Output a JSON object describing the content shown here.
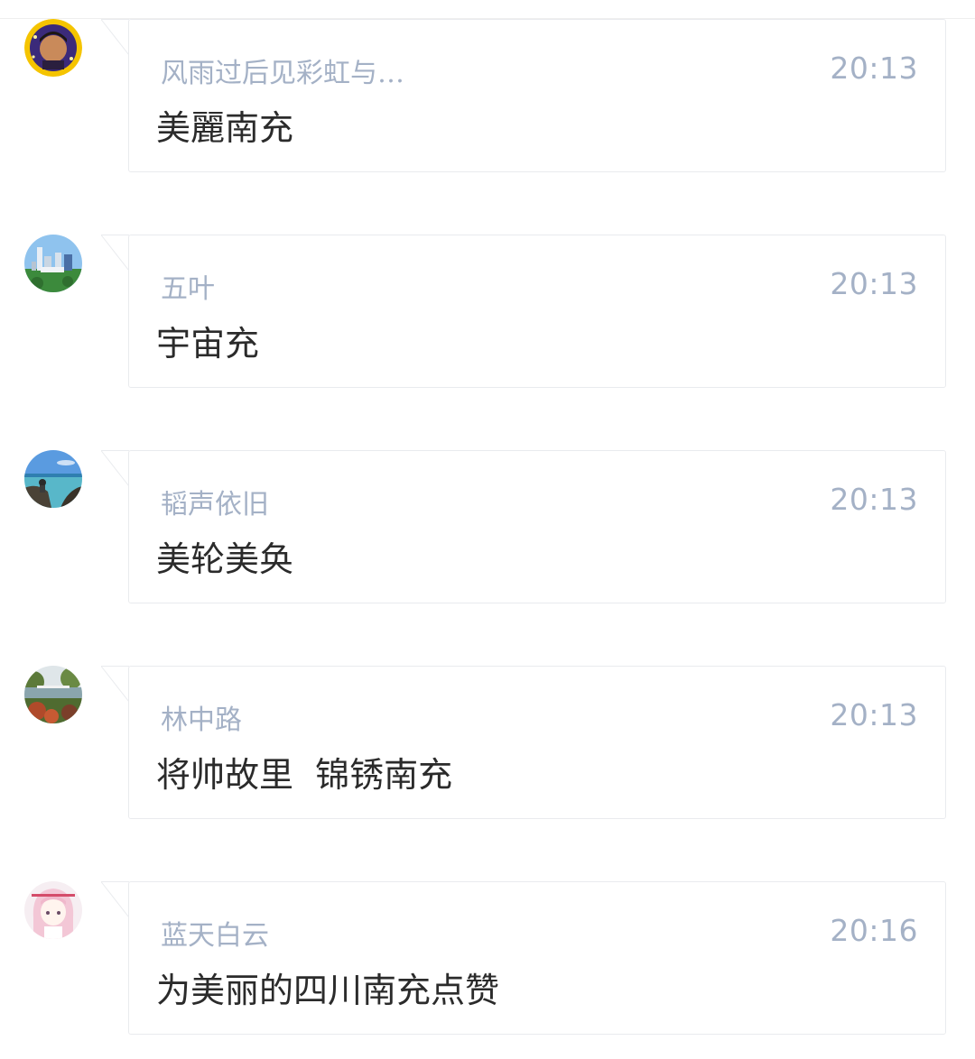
{
  "comments": [
    {
      "author": "风雨过后见彩虹与…",
      "time": "20:13",
      "text": "美麗南充",
      "avatar_icon": "portrait-avatar-icon",
      "avatar_colors": {
        "ring": "#f5c400",
        "bg": "#3b2a7a",
        "face": "#c98a5a"
      }
    },
    {
      "author": "五叶",
      "time": "20:13",
      "text": "宇宙充",
      "avatar_icon": "city-skyline-avatar-icon",
      "avatar_colors": {
        "sky": "#8fc3ee",
        "ground": "#3c8a3c",
        "building": "#e8eef5"
      }
    },
    {
      "author": "韬声依旧",
      "time": "20:13",
      "text": "美轮美奂",
      "avatar_icon": "seaside-avatar-icon",
      "avatar_colors": {
        "sky": "#5a9be0",
        "sea": "#58b7c9",
        "rock": "#4a4236"
      }
    },
    {
      "author": "林中路",
      "time": "20:13",
      "text": "将帅故里  锦锈南充",
      "avatar_icon": "park-landscape-avatar-icon",
      "avatar_colors": {
        "sky": "#dfe6e9",
        "trees": "#5c7a3a",
        "flowers": "#b04a2a"
      }
    },
    {
      "author": "蓝天白云",
      "time": "20:16",
      "text": "为美丽的四川南充点赞",
      "avatar_icon": "anime-girl-avatar-icon",
      "avatar_colors": {
        "bg": "#f6eef2",
        "hair": "#f3c7d6",
        "face": "#fff4ee"
      }
    }
  ]
}
